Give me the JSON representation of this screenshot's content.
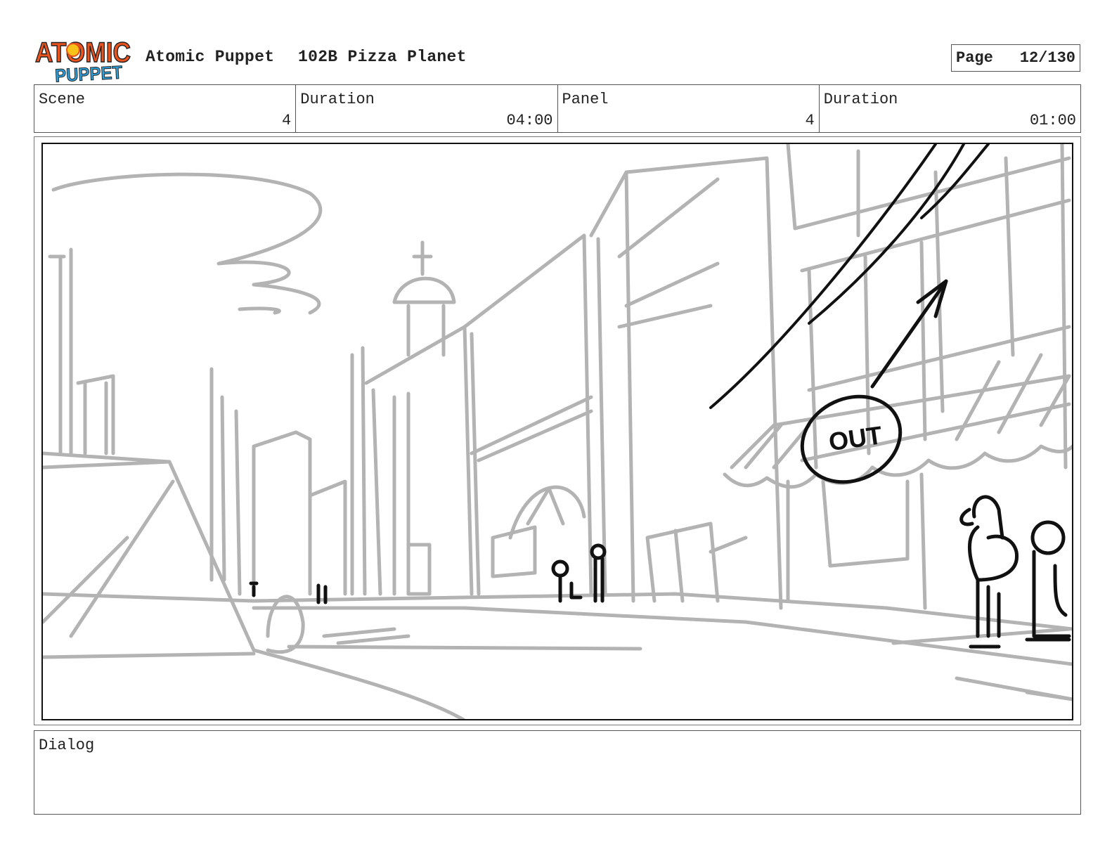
{
  "header": {
    "logo_text_top": "ATOMIC",
    "logo_text_bottom": "PUPPET",
    "studio": "Atomic Puppet",
    "episode": "102B Pizza Planet",
    "page_label": "Page",
    "page_value": "12/130"
  },
  "info": {
    "scene_label": "Scene",
    "scene_value": "4",
    "scene_duration_label": "Duration",
    "scene_duration_value": "04:00",
    "panel_label": "Panel",
    "panel_value": "4",
    "panel_duration_label": "Duration",
    "panel_duration_value": "01:00"
  },
  "panel": {
    "sign_text": "OUT",
    "sketch_color": "#b3b3b3",
    "ink_color": "#111111"
  },
  "dialog": {
    "label": "Dialog",
    "text": ""
  },
  "colors": {
    "logo_orange": "#e8531e",
    "logo_yellow": "#f7c21a",
    "logo_blue": "#2f9fd8"
  }
}
